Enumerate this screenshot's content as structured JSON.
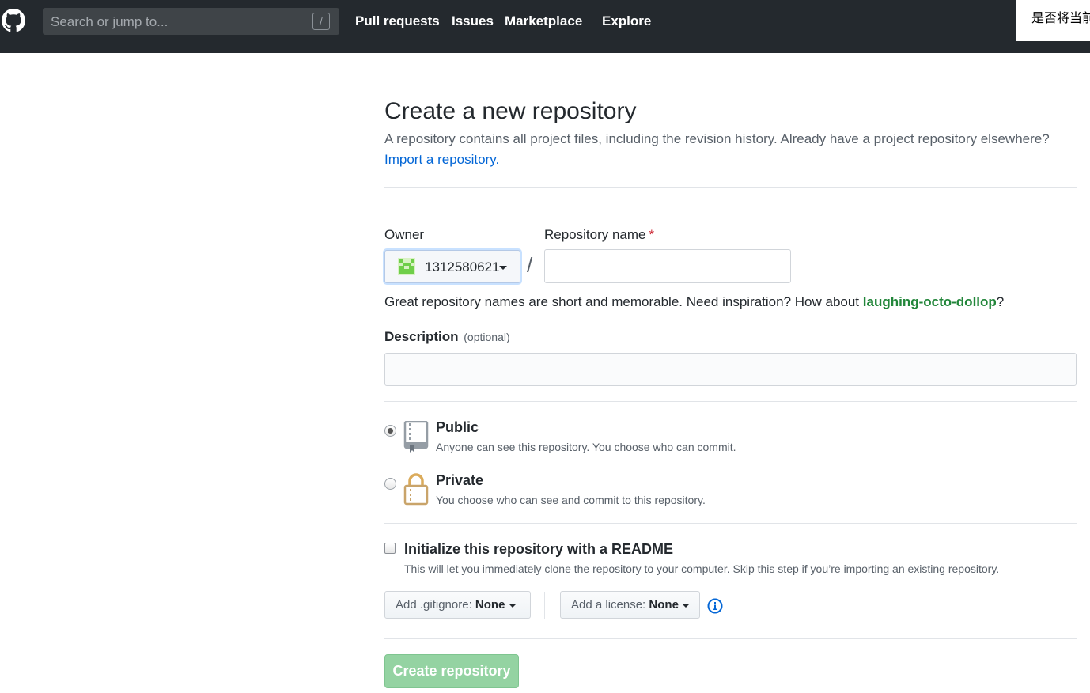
{
  "header": {
    "search_placeholder": "Search or jump to...",
    "search_shortcut": "/",
    "nav": [
      "Pull requests",
      "Issues",
      "Marketplace",
      "Explore"
    ],
    "notice_text": "是否将当前"
  },
  "page": {
    "title": "Create a new repository",
    "subtitle": "A repository contains all project files, including the revision history. Already have a project repository elsewhere?",
    "import_link": "Import a repository."
  },
  "form": {
    "owner_label": "Owner",
    "owner_value": "1312580621",
    "separator": "/",
    "repo_name_label": "Repository name",
    "required_mark": "*",
    "repo_name_value": "",
    "hint_prefix": "Great repository names are short and memorable. Need inspiration? How about ",
    "hint_suggestion": "laughing-octo-dollop",
    "hint_suffix": "?",
    "description_label": "Description",
    "description_optional": "(optional)",
    "description_value": "",
    "visibility": {
      "selected": "public",
      "public_title": "Public",
      "public_desc": "Anyone can see this repository. You choose who can commit.",
      "private_title": "Private",
      "private_desc": "You choose who can see and commit to this repository."
    },
    "readme": {
      "checked": false,
      "title": "Initialize this repository with a README",
      "desc": "This will let you immediately clone the repository to your computer. Skip this step if you’re importing an existing repository."
    },
    "gitignore_label": "Add .gitignore:",
    "gitignore_value": "None",
    "license_label": "Add a license:",
    "license_value": "None",
    "submit_label": "Create repository"
  },
  "colors": {
    "header_bg": "#24292e",
    "link": "#0366d6",
    "suggestion": "#22863a",
    "submit_disabled": "#94d3a2"
  },
  "icons": [
    "github-logo-icon",
    "repo-icon",
    "lock-icon",
    "info-icon",
    "caret-down-icon"
  ]
}
